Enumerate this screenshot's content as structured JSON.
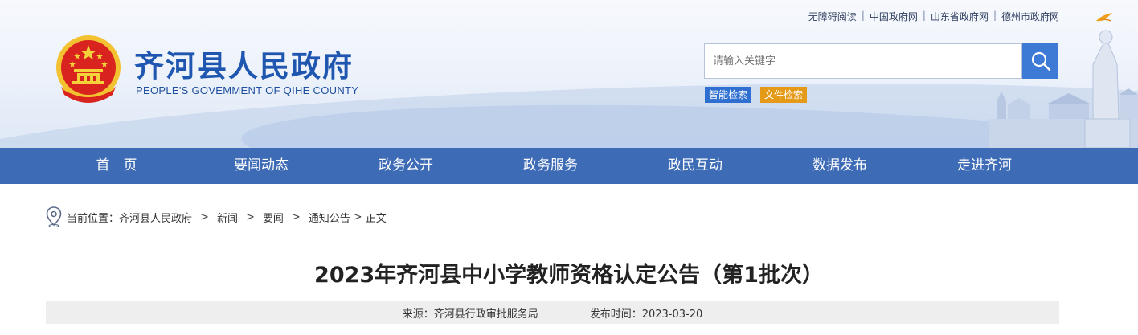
{
  "header": {
    "site_title": "齐河县人民政府",
    "site_subtitle": "PEOPLE'S GOVEMMENT OF QIHE COUNTY",
    "top_links": [
      "无障碍阅读",
      "中国政府网",
      "山东省政府网",
      "德州市政府网"
    ],
    "search": {
      "placeholder": "请输入关键字",
      "smart_search_label": "智能检索",
      "file_search_label": "文件检索"
    }
  },
  "nav": {
    "items": [
      "首　页",
      "要闻动态",
      "政务公开",
      "政务服务",
      "政民互动",
      "数据发布",
      "走进齐河"
    ]
  },
  "breadcrumb": {
    "prefix": "当前位置：",
    "items": [
      "齐河县人民政府",
      "新闻",
      "要闻",
      "通知公告",
      "正文"
    ],
    "separator": ">"
  },
  "article": {
    "title": "2023年齐河县中小学教师资格认定公告（第1批次）",
    "source_label": "来源：齐河县行政审批服务局",
    "publish_label": "发布时间：2023-03-20"
  },
  "colors": {
    "nav_bg": "#3d6bb6",
    "title_blue": "#1e56b0",
    "search_button": "#3d7ad6",
    "smart_tag": "#2f6fd0",
    "file_tag": "#e59a17"
  },
  "icons": [
    "national-emblem",
    "search-icon",
    "location-pin-icon",
    "bird-icon",
    "statue-illustration"
  ]
}
